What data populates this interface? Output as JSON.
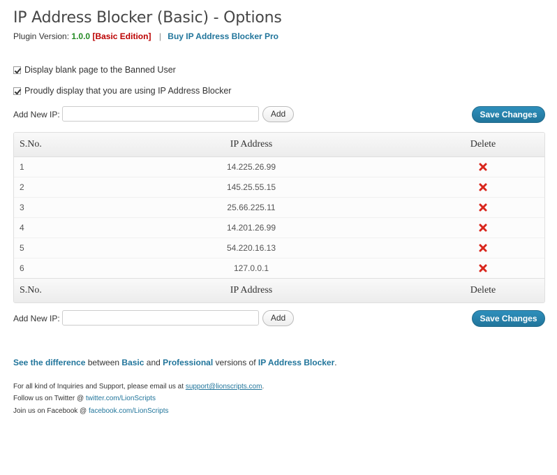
{
  "header": {
    "title": "IP Address Blocker (Basic) - Options",
    "version_label": "Plugin Version:",
    "version": "1.0.0",
    "edition": "[Basic Edition]",
    "separator": "|",
    "buy_link": "Buy IP Address Blocker Pro"
  },
  "options": [
    {
      "label": "Display blank page to the Banned User",
      "checked": true
    },
    {
      "label": "Proudly display that you are using IP Address Blocker",
      "checked": true
    }
  ],
  "add_form": {
    "label": "Add New IP:",
    "input_value": "",
    "add_label": "Add",
    "save_label": "Save Changes"
  },
  "table": {
    "columns": [
      "S.No.",
      "IP Address",
      "Delete"
    ],
    "rows": [
      {
        "sno": "1",
        "ip": "14.225.26.99"
      },
      {
        "sno": "2",
        "ip": "145.25.55.15"
      },
      {
        "sno": "3",
        "ip": "25.66.225.11"
      },
      {
        "sno": "4",
        "ip": "14.201.26.99"
      },
      {
        "sno": "5",
        "ip": "54.220.16.13"
      },
      {
        "sno": "6",
        "ip": "127.0.0.1"
      }
    ]
  },
  "footer": {
    "diff": {
      "link": "See the difference",
      "between": " between ",
      "basic": "Basic",
      "and": " and ",
      "pro": "Professional",
      "versions_of": " versions of ",
      "product": "IP Address Blocker",
      "end": "."
    },
    "support_text": "For all kind of Inquiries and Support, please email us at ",
    "support_email": "support@lionscripts.com",
    "support_end": ".",
    "twitter_text": "Follow us on Twitter @ ",
    "twitter_link": "twitter.com/LionScripts",
    "facebook_text": "Join us on Facebook @ ",
    "facebook_link": "facebook.com/LionScripts"
  },
  "colors": {
    "link": "#21759b",
    "version": "#238a23",
    "edition": "#bb0000",
    "delete_icon": "#d9261c",
    "save_button": "#21759b"
  },
  "icons": {
    "delete": "red-x-icon"
  }
}
